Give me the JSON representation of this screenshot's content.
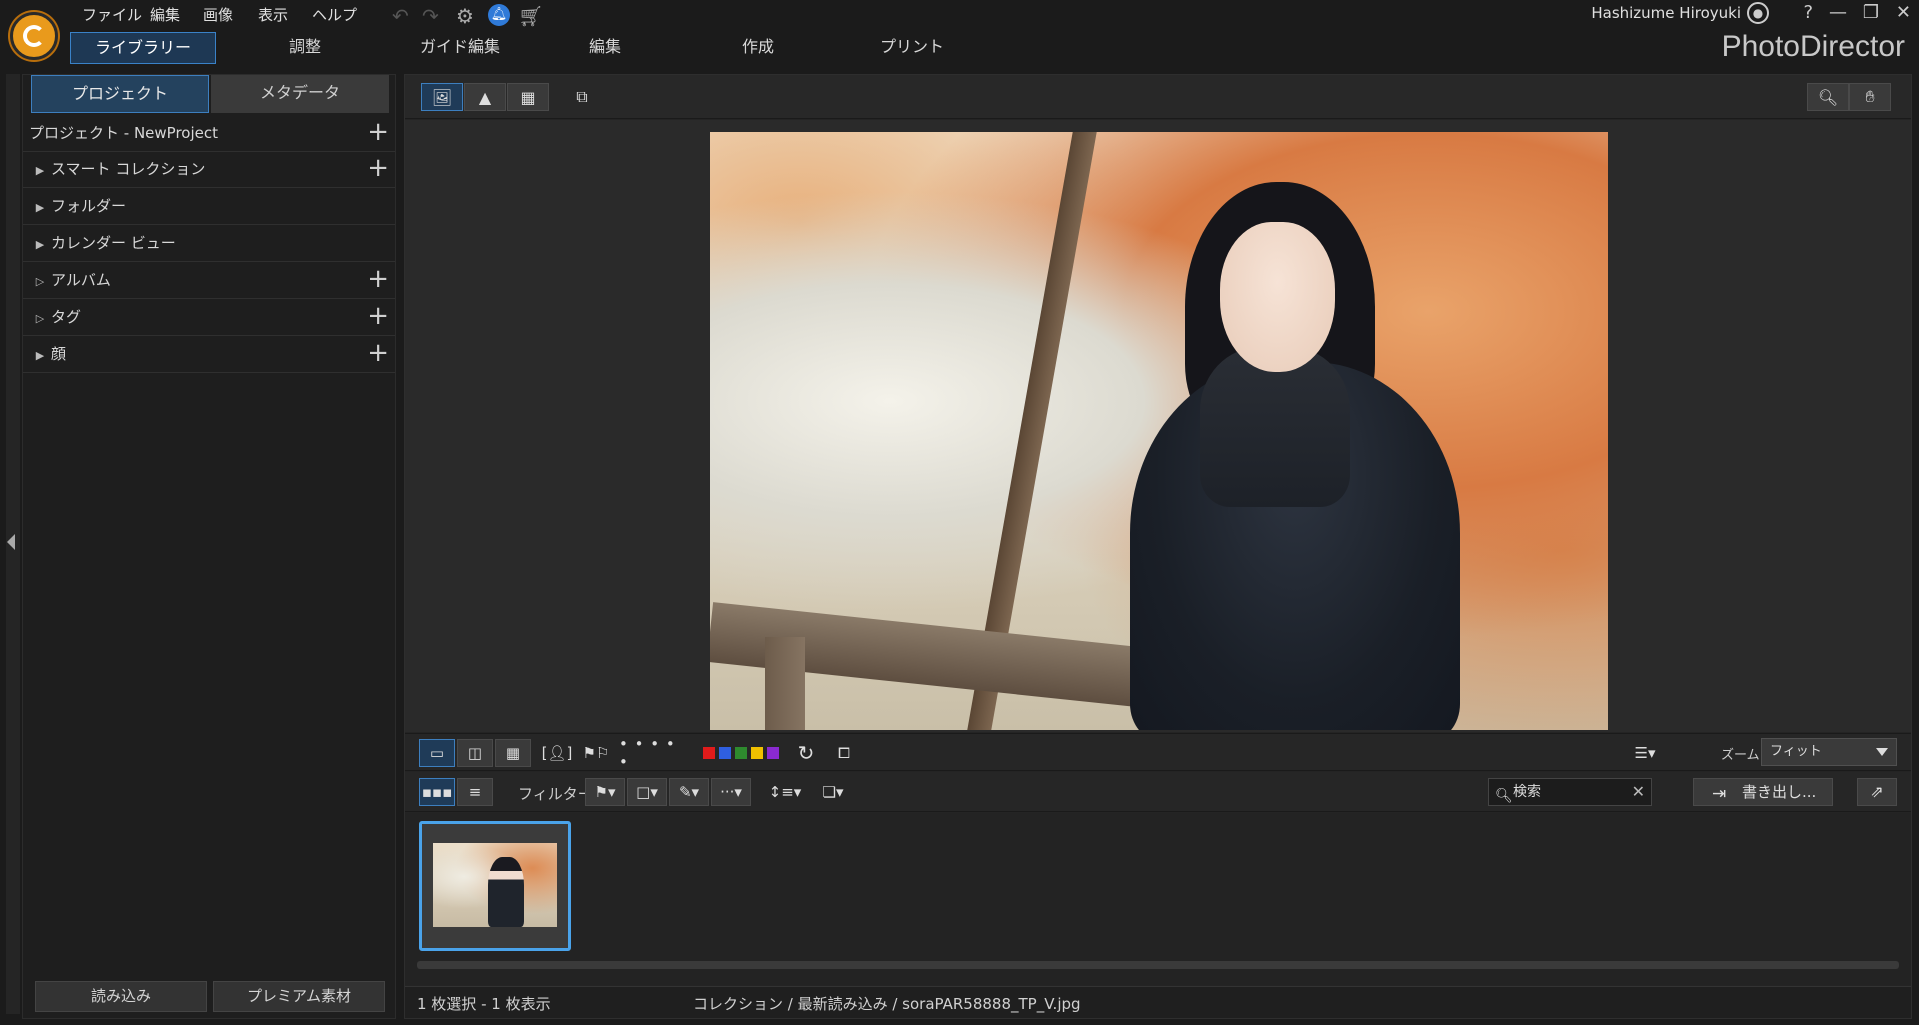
{
  "app": {
    "title": "PhotoDirector",
    "user": "Hashizume Hiroyuki"
  },
  "menu": [
    "ファイル",
    "編集",
    "画像",
    "表示",
    "ヘルプ"
  ],
  "window_controls": {
    "help": "?",
    "minimize": "—",
    "restore": "❐",
    "close": "✕"
  },
  "modules": [
    {
      "label": "ライブラリー",
      "active": true
    },
    {
      "label": "調整",
      "active": false
    },
    {
      "label": "ガイド編集",
      "active": false
    },
    {
      "label": "編集",
      "active": false
    },
    {
      "label": "作成",
      "active": false
    },
    {
      "label": "プリント",
      "active": false
    }
  ],
  "left_panel": {
    "tabs": [
      {
        "label": "プロジェクト",
        "active": true
      },
      {
        "label": "メタデータ",
        "active": false
      }
    ],
    "project_title": "プロジェクト - NewProject",
    "items": [
      {
        "label": "スマート コレクション",
        "expander": "filled",
        "addable": true
      },
      {
        "label": "フォルダー",
        "expander": "filled",
        "addable": false
      },
      {
        "label": "カレンダー ビュー",
        "expander": "filled",
        "addable": false
      },
      {
        "label": "アルバム",
        "expander": "outline",
        "addable": true
      },
      {
        "label": "タグ",
        "expander": "outline",
        "addable": true
      },
      {
        "label": "顔",
        "expander": "filled",
        "addable": true
      }
    ],
    "buttons": {
      "import": "読み込み",
      "premium": "プレミアム素材"
    }
  },
  "toolbar": {
    "filter_label": "フィルター:",
    "zoom_label": "ズーム:",
    "zoom_value": "フィット",
    "rating_dots": "• • • • •"
  },
  "color_labels": [
    "#e01b1b",
    "#2f5fe0",
    "#2e8a2e",
    "#f0c000",
    "#8a2ad0"
  ],
  "search": {
    "placeholder": "検索"
  },
  "export_label": "書き出し...",
  "status": {
    "selection": "1 枚選択 - 1 枚表示",
    "path": "コレクション / 最新読み込み / soraPAR58888_TP_V.jpg"
  }
}
